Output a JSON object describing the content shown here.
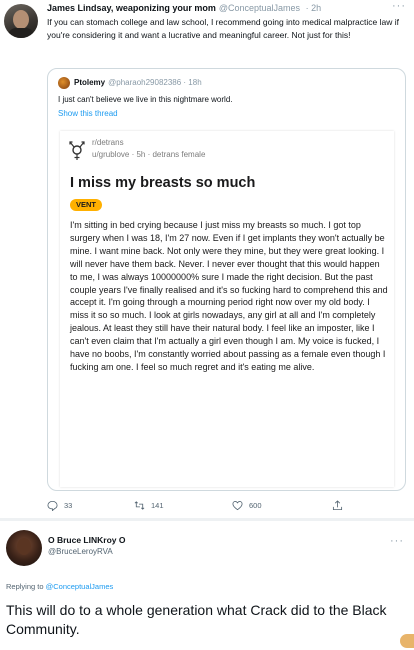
{
  "top_tweet": {
    "author_name": "James Lindsay, weaponizing your mom",
    "author_handle": "@ConceptualJames",
    "time": "· 2h",
    "more": "···",
    "text": "If you can stomach college and law school, I recommend going into medical malpractice law if you're considering it and want a lucrative and meaningful career. Not just for this!",
    "quoted": {
      "author_name": "Ptolemy",
      "author_handle": "@pharaoh29082386 · 18h",
      "text": "I just can't believe we live in this nightmare world.",
      "show_thread": "Show this thread",
      "reddit_post": {
        "subreddit": "r/detrans",
        "user_line": "u/grublove · 5h · detrans female",
        "title": "I miss my breasts so much",
        "flair": "VENT",
        "body": "I'm sitting in bed crying because I just miss my breasts so much. I got top surgery when I was 18, I'm 27 now. Even if I get implants they won't actually be mine. I want mine back. Not only were they mine, but they were great looking. I will never have them back. Never. I never ever thought that this would happen to me, I was always 10000000% sure I made the right decision.  But the past couple years I've finally realised and it's so fucking hard to comprehend this and accept it. I'm going through a mourning period right now over my old body. I miss it so so much. I look at girls nowadays, any girl at all and I'm completely jealous. At least they still have their natural body. I feel like an imposter, like I can't even claim that I'm actually a girl even though I am. My voice is fucked, I have no boobs, I'm constantly worried about passing as a female even though I fucking am one. I feel so much regret and it's eating me alive."
      }
    },
    "actions": {
      "replies": "33",
      "retweets": "141",
      "likes": "600"
    }
  },
  "reply": {
    "author_name": "O Bruce LINKroy O",
    "author_handle": "@BruceLeroyRVA",
    "more": "···",
    "replying_to_label": "Replying to",
    "replying_to_handle": "@ConceptualJames",
    "text": "This will do to a whole generation what Crack did to the Black Community."
  },
  "colors": {
    "link_blue": "#1d9bf0",
    "muted_gray": "#536471",
    "flair_gold": "#ffb000"
  }
}
